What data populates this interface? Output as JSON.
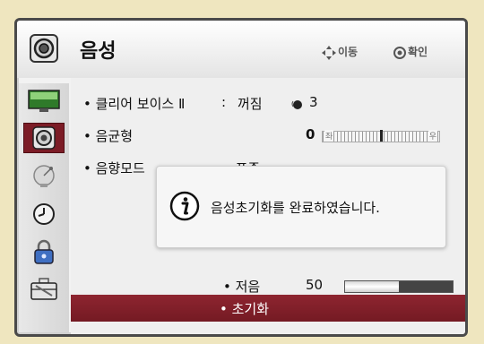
{
  "header": {
    "title": "음성",
    "icon": "speaker-icon",
    "hint_move": "이동",
    "hint_ok": "확인"
  },
  "sidebar": {
    "items": [
      {
        "icon": "tv-picture-icon",
        "active": false
      },
      {
        "icon": "speaker-icon",
        "active": true
      },
      {
        "icon": "satellite-dish-icon",
        "active": false
      },
      {
        "icon": "clock-icon",
        "active": false
      },
      {
        "icon": "lock-icon",
        "active": false
      },
      {
        "icon": "toolbox-icon",
        "active": false
      }
    ]
  },
  "menu": {
    "clear_voice": {
      "label": "• 클리어 보이스 Ⅱ",
      "separator": ":",
      "value": "꺼짐",
      "level": "3",
      "icon": "voice-icon"
    },
    "balance": {
      "label": "• 음균형",
      "value": "0",
      "left_label": "좌",
      "right_label": "우",
      "position": 0.5
    },
    "sound_mode": {
      "label": "• 음향모드",
      "value": "• 표준"
    },
    "bass": {
      "label": "• 저음",
      "value": "50",
      "fraction": 0.5
    },
    "reset": {
      "label": "• 초기화",
      "selected": true
    }
  },
  "popup": {
    "icon": "info-icon",
    "message": "음성초기화를 완료하였습니다."
  }
}
